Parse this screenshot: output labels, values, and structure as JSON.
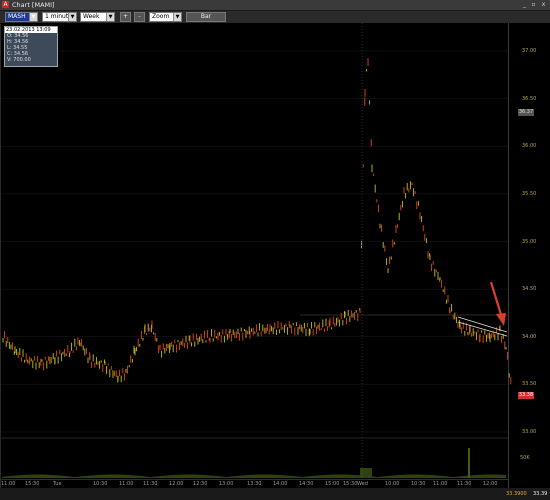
{
  "window": {
    "title": "Chart [MAMI]",
    "min_label": "_",
    "max_label": "▫",
    "close_label": "x"
  },
  "toolbar": {
    "symbol": "MASH",
    "interval": "1 minute",
    "period": "Week",
    "plus_label": "+",
    "minus_label": "-",
    "zoom": "Zoom",
    "bar_label": "Bar"
  },
  "info_box": {
    "header": "23.02.2013 13:09",
    "open": "O: 34.56",
    "high": "H: 34.56",
    "low": "L: 34.55",
    "close": "C: 34.56",
    "volume": "V: 700.00"
  },
  "price_scale": [
    "37.00",
    "36.50",
    "36.00",
    "35.50",
    "35.00",
    "34.50",
    "34.00",
    "33.50",
    "33.00"
  ],
  "price_tags": {
    "current": "33.38",
    "highlight": "36.37"
  },
  "volume_scale": "50K",
  "x_axis": [
    "11:00",
    "15:30",
    "Tue",
    "10:30",
    "11:00",
    "11:30",
    "12:00",
    "12:30",
    "13:00",
    "13:30",
    "14:00",
    "14:30",
    "15:00",
    "15:30",
    "Wed",
    "10:00",
    "10:30",
    "11:00",
    "11:30",
    "12:00",
    "12:30"
  ],
  "status_bar": {
    "left": "33.3900",
    "right": "33.39"
  },
  "colors": {
    "up": "#c6c31a",
    "down": "#e04a1a",
    "arrow": "#d8402c",
    "trend": "#e8e2d0"
  }
}
